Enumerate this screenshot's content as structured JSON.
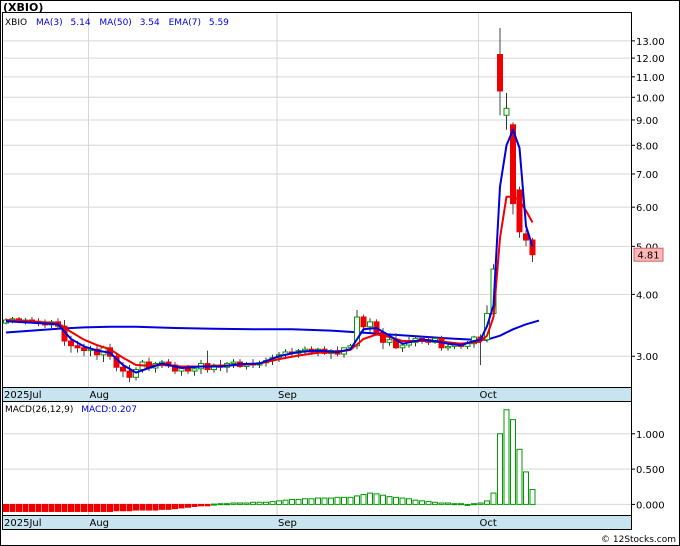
{
  "ticker_label": "(XBIO)",
  "legend": {
    "symbol": "XBIO",
    "ma3": "MA(3)",
    "ma3_val": "5.14",
    "ma50": "MA(50)",
    "ma50_val": "3.54",
    "ema7": "EMA(7)",
    "ema7_val": "5.59"
  },
  "last_price": "4.81",
  "macd_legend": {
    "params": "MACD(26,12,9)",
    "value": "MACD:0.207"
  },
  "watermark": "© 12Stocks.com",
  "colors": {
    "up": "#009900",
    "down": "#ee0000",
    "ma_blue": "#0000dd",
    "ema_red": "#ee0000",
    "axis_band": "#c8e4ee",
    "grid": "#d6d6d6"
  },
  "chart_data": [
    {
      "type": "candlestick",
      "scale": "log",
      "ylim": [
        2.6,
        14.8
      ],
      "yticks": [
        3.0,
        4.0,
        5.0,
        6.0,
        7.0,
        8.0,
        9.0,
        10.0,
        11.0,
        12.0,
        13.0
      ],
      "ytick_labels": [
        "3.00",
        "4.00",
        "5.00",
        "6.00",
        "7.00",
        "8.00",
        "9.00",
        "10.00",
        "11.00",
        "12.00",
        "13.00"
      ],
      "x_labels": [
        {
          "label": "2025Jul",
          "index": 0
        },
        {
          "label": "Aug",
          "index": 13
        },
        {
          "label": "Sep",
          "index": 42
        },
        {
          "label": "Oct",
          "index": 73
        }
      ],
      "ohlc": [
        [
          3.5,
          3.58,
          3.48,
          3.55
        ],
        [
          3.55,
          3.6,
          3.5,
          3.57
        ],
        [
          3.57,
          3.6,
          3.5,
          3.52
        ],
        [
          3.52,
          3.58,
          3.48,
          3.55
        ],
        [
          3.55,
          3.6,
          3.5,
          3.53
        ],
        [
          3.53,
          3.58,
          3.45,
          3.5
        ],
        [
          3.5,
          3.56,
          3.42,
          3.47
        ],
        [
          3.47,
          3.55,
          3.42,
          3.52
        ],
        [
          3.52,
          3.58,
          3.4,
          3.45
        ],
        [
          3.45,
          3.55,
          3.15,
          3.22
        ],
        [
          3.22,
          3.3,
          3.05,
          3.15
        ],
        [
          3.15,
          3.22,
          3.05,
          3.12
        ],
        [
          3.12,
          3.18,
          3.0,
          3.08
        ],
        [
          3.08,
          3.15,
          3.0,
          3.1
        ],
        [
          3.1,
          3.15,
          2.95,
          3.02
        ],
        [
          3.02,
          3.15,
          2.92,
          3.12
        ],
        [
          3.12,
          3.18,
          2.95,
          3.0
        ],
        [
          3.0,
          3.05,
          2.8,
          2.85
        ],
        [
          2.85,
          2.92,
          2.72,
          2.8
        ],
        [
          2.8,
          2.88,
          2.66,
          2.72
        ],
        [
          2.72,
          2.85,
          2.68,
          2.82
        ],
        [
          2.82,
          2.95,
          2.78,
          2.92
        ],
        [
          2.92,
          2.98,
          2.8,
          2.84
        ],
        [
          2.84,
          2.92,
          2.78,
          2.9
        ],
        [
          2.9,
          2.95,
          2.84,
          2.92
        ],
        [
          2.92,
          2.96,
          2.84,
          2.88
        ],
        [
          2.88,
          2.92,
          2.76,
          2.8
        ],
        [
          2.8,
          2.86,
          2.74,
          2.84
        ],
        [
          2.84,
          2.88,
          2.76,
          2.8
        ],
        [
          2.8,
          2.86,
          2.74,
          2.83
        ],
        [
          2.83,
          2.95,
          2.76,
          2.9
        ],
        [
          2.9,
          3.08,
          2.78,
          2.82
        ],
        [
          2.82,
          2.9,
          2.78,
          2.88
        ],
        [
          2.88,
          2.95,
          2.8,
          2.85
        ],
        [
          2.85,
          2.92,
          2.78,
          2.9
        ],
        [
          2.9,
          2.96,
          2.84,
          2.92
        ],
        [
          2.92,
          2.96,
          2.84,
          2.86
        ],
        [
          2.86,
          2.92,
          2.82,
          2.9
        ],
        [
          2.9,
          2.96,
          2.84,
          2.88
        ],
        [
          2.88,
          2.94,
          2.84,
          2.91
        ],
        [
          2.91,
          2.98,
          2.86,
          2.94
        ],
        [
          2.94,
          3.02,
          2.88,
          2.98
        ],
        [
          2.98,
          3.06,
          2.92,
          3.02
        ],
        [
          3.02,
          3.1,
          2.96,
          3.06
        ],
        [
          3.06,
          3.12,
          3.0,
          3.04
        ],
        [
          3.04,
          3.1,
          2.98,
          3.08
        ],
        [
          3.08,
          3.14,
          3.02,
          3.1
        ],
        [
          3.1,
          3.14,
          3.02,
          3.06
        ],
        [
          3.06,
          3.12,
          3.0,
          3.1
        ],
        [
          3.1,
          3.14,
          3.02,
          3.04
        ],
        [
          3.04,
          3.1,
          2.96,
          3.08
        ],
        [
          3.08,
          3.14,
          3.0,
          3.03
        ],
        [
          3.03,
          3.1,
          2.98,
          3.12
        ],
        [
          3.12,
          3.18,
          3.08,
          3.15
        ],
        [
          3.15,
          3.72,
          3.1,
          3.6
        ],
        [
          3.6,
          3.64,
          3.36,
          3.44
        ],
        [
          3.44,
          3.58,
          3.36,
          3.52
        ],
        [
          3.52,
          3.56,
          3.3,
          3.35
        ],
        [
          3.35,
          3.42,
          3.1,
          3.2
        ],
        [
          3.2,
          3.3,
          3.15,
          3.24
        ],
        [
          3.24,
          3.34,
          3.1,
          3.12
        ],
        [
          3.12,
          3.2,
          3.06,
          3.16
        ],
        [
          3.16,
          3.28,
          3.12,
          3.2
        ],
        [
          3.2,
          3.3,
          3.14,
          3.26
        ],
        [
          3.26,
          3.3,
          3.18,
          3.24
        ],
        [
          3.24,
          3.28,
          3.16,
          3.2
        ],
        [
          3.2,
          3.28,
          3.18,
          3.26
        ],
        [
          3.26,
          3.3,
          3.08,
          3.12
        ],
        [
          3.12,
          3.2,
          3.08,
          3.14
        ],
        [
          3.14,
          3.2,
          3.1,
          3.16
        ],
        [
          3.16,
          3.2,
          3.1,
          3.14
        ],
        [
          3.14,
          3.22,
          3.1,
          3.18
        ],
        [
          3.18,
          3.3,
          3.12,
          3.28
        ],
        [
          3.28,
          3.32,
          2.88,
          3.24
        ],
        [
          3.24,
          3.8,
          3.2,
          3.66
        ],
        [
          3.66,
          4.6,
          3.6,
          4.5
        ],
        [
          12.2,
          13.8,
          9.2,
          10.3
        ],
        [
          9.2,
          10.2,
          8.6,
          9.5
        ],
        [
          8.8,
          8.9,
          5.8,
          6.1
        ],
        [
          6.5,
          6.6,
          5.2,
          5.35
        ],
        [
          5.3,
          5.4,
          5.0,
          5.15
        ],
        [
          5.15,
          5.2,
          4.65,
          4.81
        ]
      ],
      "ma3": [
        [
          0,
          3.53
        ],
        [
          8,
          3.48
        ],
        [
          10,
          3.25
        ],
        [
          12,
          3.14
        ],
        [
          14,
          3.08
        ],
        [
          16,
          3.05
        ],
        [
          18,
          2.88
        ],
        [
          20,
          2.78
        ],
        [
          22,
          2.84
        ],
        [
          24,
          2.9
        ],
        [
          27,
          2.84
        ],
        [
          30,
          2.86
        ],
        [
          33,
          2.86
        ],
        [
          36,
          2.89
        ],
        [
          39,
          2.9
        ],
        [
          42,
          3.0
        ],
        [
          45,
          3.06
        ],
        [
          48,
          3.08
        ],
        [
          51,
          3.06
        ],
        [
          53,
          3.1
        ],
        [
          55,
          3.4
        ],
        [
          57,
          3.42
        ],
        [
          59,
          3.3
        ],
        [
          61,
          3.18
        ],
        [
          64,
          3.24
        ],
        [
          66,
          3.22
        ],
        [
          68,
          3.18
        ],
        [
          70,
          3.16
        ],
        [
          72,
          3.22
        ],
        [
          73,
          3.24
        ],
        [
          74,
          3.45
        ],
        [
          75,
          3.8
        ],
        [
          76,
          6.6
        ],
        [
          77,
          8.0
        ],
        [
          78,
          8.6
        ],
        [
          79,
          7.9
        ],
        [
          80,
          5.5
        ],
        [
          81,
          5.0
        ]
      ],
      "ema7": [
        [
          0,
          3.55
        ],
        [
          8,
          3.5
        ],
        [
          10,
          3.36
        ],
        [
          12,
          3.24
        ],
        [
          14,
          3.16
        ],
        [
          16,
          3.1
        ],
        [
          18,
          2.98
        ],
        [
          20,
          2.88
        ],
        [
          22,
          2.87
        ],
        [
          24,
          2.88
        ],
        [
          27,
          2.86
        ],
        [
          30,
          2.86
        ],
        [
          33,
          2.87
        ],
        [
          36,
          2.88
        ],
        [
          39,
          2.9
        ],
        [
          42,
          2.96
        ],
        [
          45,
          3.01
        ],
        [
          48,
          3.05
        ],
        [
          51,
          3.06
        ],
        [
          53,
          3.09
        ],
        [
          55,
          3.25
        ],
        [
          57,
          3.32
        ],
        [
          59,
          3.28
        ],
        [
          61,
          3.22
        ],
        [
          64,
          3.22
        ],
        [
          66,
          3.22
        ],
        [
          68,
          3.2
        ],
        [
          70,
          3.18
        ],
        [
          72,
          3.2
        ],
        [
          73,
          3.21
        ],
        [
          74,
          3.3
        ],
        [
          75,
          3.6
        ],
        [
          76,
          5.2
        ],
        [
          77,
          6.3
        ],
        [
          78,
          6.3
        ],
        [
          79,
          6.2
        ],
        [
          80,
          5.9
        ],
        [
          81,
          5.59
        ]
      ],
      "ma50": [
        [
          0,
          3.35
        ],
        [
          4,
          3.38
        ],
        [
          8,
          3.41
        ],
        [
          12,
          3.43
        ],
        [
          16,
          3.44
        ],
        [
          20,
          3.44
        ],
        [
          26,
          3.42
        ],
        [
          32,
          3.41
        ],
        [
          38,
          3.4
        ],
        [
          44,
          3.4
        ],
        [
          50,
          3.38
        ],
        [
          56,
          3.34
        ],
        [
          62,
          3.3
        ],
        [
          68,
          3.26
        ],
        [
          72,
          3.24
        ],
        [
          74,
          3.24
        ],
        [
          76,
          3.3
        ],
        [
          78,
          3.4
        ],
        [
          80,
          3.48
        ],
        [
          82,
          3.54
        ]
      ]
    },
    {
      "type": "bar",
      "title": "MACD(26,12,9)",
      "ylim": [
        -0.15,
        1.45
      ],
      "yticks": [
        0.0,
        0.5,
        1.0
      ],
      "ytick_labels": [
        "0.000",
        "0.500",
        "1.000"
      ],
      "values": [
        -0.1,
        -0.1,
        -0.1,
        -0.1,
        -0.1,
        -0.1,
        -0.1,
        -0.1,
        -0.1,
        -0.1,
        -0.1,
        -0.1,
        -0.1,
        -0.1,
        -0.1,
        -0.1,
        -0.1,
        -0.09,
        -0.09,
        -0.09,
        -0.08,
        -0.08,
        -0.08,
        -0.08,
        -0.07,
        -0.07,
        -0.06,
        -0.05,
        -0.04,
        -0.03,
        -0.02,
        -0.02,
        0.005,
        0.01,
        0.01,
        0.02,
        0.02,
        0.02,
        0.03,
        0.03,
        0.03,
        0.04,
        0.05,
        0.06,
        0.07,
        0.07,
        0.08,
        0.08,
        0.09,
        0.09,
        0.09,
        0.1,
        0.1,
        0.1,
        0.12,
        0.14,
        0.16,
        0.15,
        0.13,
        0.11,
        0.1,
        0.09,
        0.08,
        0.06,
        0.05,
        0.04,
        0.03,
        0.02,
        0.02,
        0.01,
        0.01,
        0.0,
        0.01,
        0.02,
        0.05,
        0.16,
        1.0,
        1.34,
        1.2,
        0.78,
        0.46,
        0.21
      ]
    }
  ]
}
